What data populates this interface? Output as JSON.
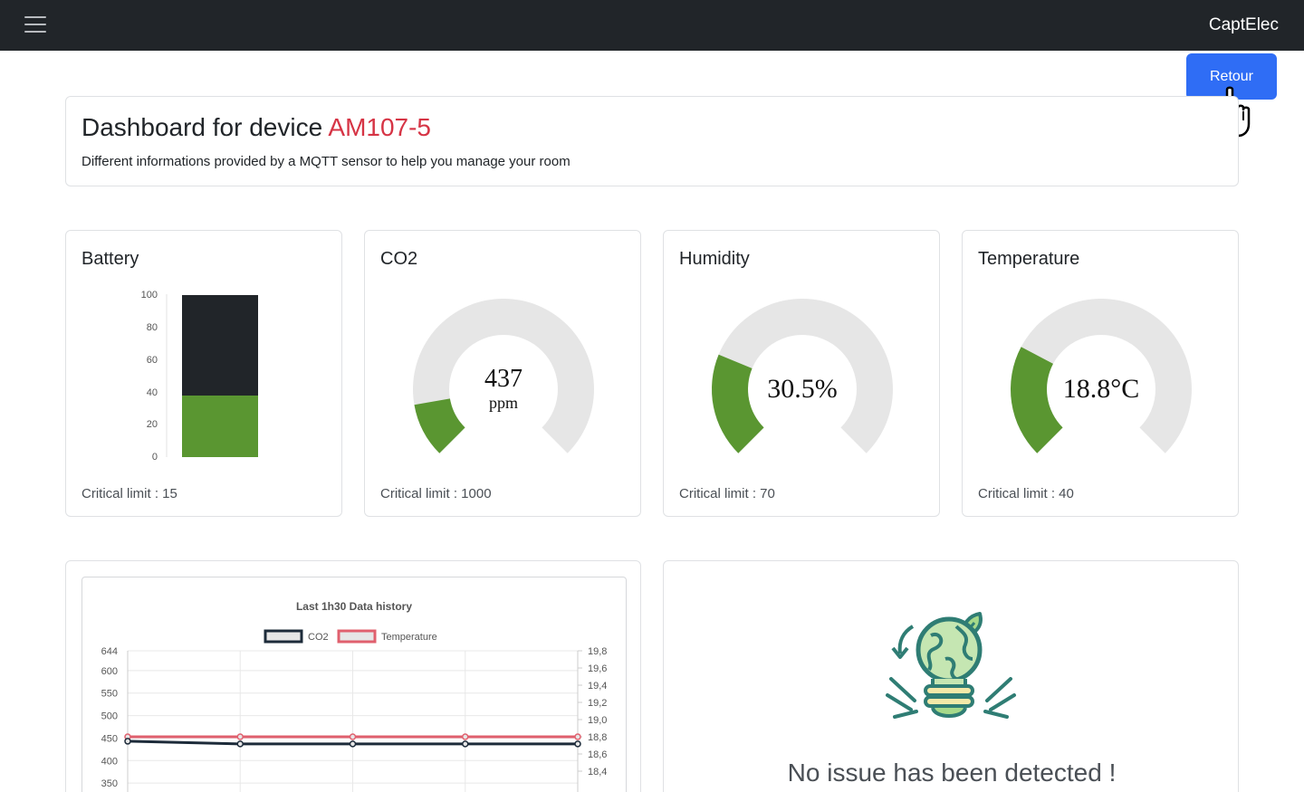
{
  "navbar": {
    "brand": "CaptElec",
    "menu_icon": "hamburger-icon"
  },
  "actions": {
    "back_label": "Retour"
  },
  "header": {
    "title_prefix": "Dashboard for device ",
    "device_id": "AM107-5",
    "subtitle": "Different informations provided by a MQTT sensor to help you manage your room"
  },
  "metrics": [
    {
      "title": "Battery",
      "limit_text": "Critical limit : 15",
      "type": "bar",
      "value": 38,
      "max": 100,
      "axis_ticks": [
        "100",
        "80",
        "60",
        "40",
        "20",
        "0"
      ]
    },
    {
      "title": "CO2",
      "value_text": "437",
      "unit_text": "ppm",
      "limit_text": "Critical limit : 1000",
      "type": "gauge",
      "fraction": 0.13
    },
    {
      "title": "Humidity",
      "value_text": "30.5%",
      "limit_text": "Critical limit : 70",
      "type": "gauge",
      "fraction": 0.25
    },
    {
      "title": "Temperature",
      "value_text": "18.8°C",
      "limit_text": "Critical limit : 40",
      "type": "gauge",
      "fraction": 0.27
    }
  ],
  "colors": {
    "accent": "#2f6df5",
    "ok_green": "#5a9631",
    "dark_fill": "#212529",
    "track_grey": "#e6e6e6",
    "device_red": "#d63445",
    "co2_line": "#1d2b3a",
    "temp_line": "#e0606e"
  },
  "chart_data": {
    "type": "line",
    "title": "Last 1h30 Data history",
    "legend_position": "top",
    "grid": true,
    "x": [
      0,
      1,
      2,
      3,
      4
    ],
    "series": [
      {
        "name": "CO2",
        "axis": "left",
        "values": [
          443,
          437,
          437,
          437,
          437
        ]
      },
      {
        "name": "Temperature",
        "axis": "right",
        "values": [
          18.8,
          18.8,
          18.8,
          18.8,
          18.8
        ]
      }
    ],
    "y_left_ticks": [
      "644",
      "600",
      "550",
      "500",
      "450",
      "400",
      "350"
    ],
    "y_left_ylim": [
      300,
      644
    ],
    "y_right_ticks": [
      "19,8",
      "19,6",
      "19,4",
      "19,2",
      "19,0",
      "18,8",
      "18,6",
      "18,4"
    ],
    "y_right_ylim": [
      18.0,
      19.8
    ]
  },
  "status": {
    "message": "No issue has been detected !",
    "icon": "eco-lightbulb-icon"
  }
}
